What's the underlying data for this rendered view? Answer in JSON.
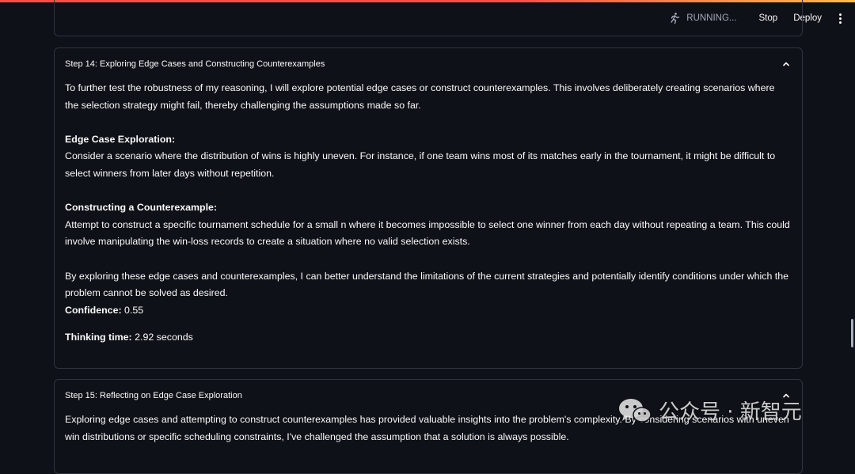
{
  "header": {
    "status_text": "RUNNING...",
    "stop_label": "Stop",
    "deploy_label": "Deploy"
  },
  "steps": [
    {
      "title": "Step 14: Exploring Edge Cases and Constructing Counterexamples",
      "intro": "To further test the robustness of my reasoning, I will explore potential edge cases or construct counterexamples. This involves deliberately creating scenarios where the selection strategy might fail, thereby challenging the assumptions made so far.",
      "sections": [
        {
          "heading": "Edge Case Exploration:",
          "text": "Consider a scenario where the distribution of wins is highly uneven. For instance, if one team wins most of its matches early in the tournament, it might be difficult to select winners from later days without repetition."
        },
        {
          "heading": "Constructing a Counterexample:",
          "text": "Attempt to construct a specific tournament schedule for a small n where it becomes impossible to select one winner from each day without repeating a team. This could involve manipulating the win-loss records to create a situation where no valid selection exists."
        }
      ],
      "conclusion": "By exploring these edge cases and counterexamples, I can better understand the limitations of the current strategies and potentially identify conditions under which the problem cannot be solved as desired.",
      "confidence_label": "Confidence:",
      "confidence_value": "0.55",
      "time_label": "Thinking time:",
      "time_value": "2.92 seconds"
    },
    {
      "title": "Step 15: Reflecting on Edge Case Exploration",
      "intro": "Exploring edge cases and attempting to construct counterexamples has provided valuable insights into the problem's complexity. By considering scenarios with uneven win distributions or specific scheduling constraints, I've challenged the assumption that a solution is always possible."
    }
  ],
  "watermark": {
    "text": "公众号 · 新智元"
  },
  "icons": {
    "running": "running-person-icon",
    "collapse": "chevron-up-icon",
    "menu": "kebab-menu-icon",
    "watermark": "wechat-icon"
  },
  "colors": {
    "background": "#0e1117",
    "border": "#31333f",
    "text": "#fafafa",
    "status": "#a3a8b8",
    "accent": "#ff4b4b"
  }
}
